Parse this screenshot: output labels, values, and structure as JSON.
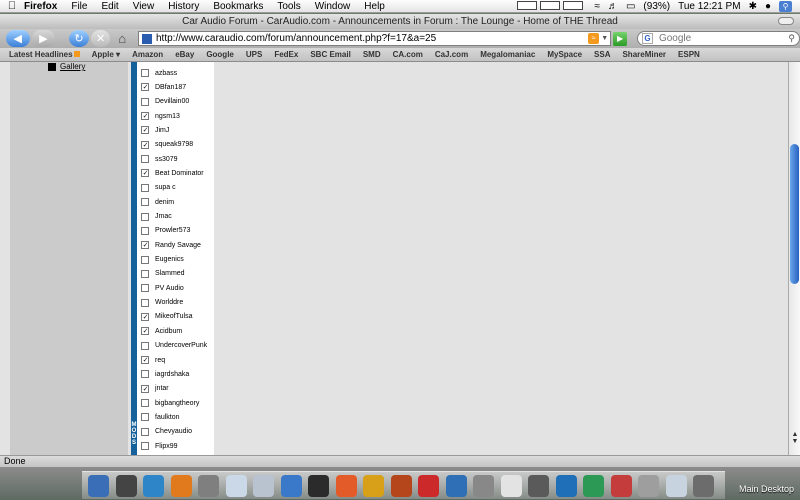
{
  "menubar": {
    "app": "Firefox",
    "items": [
      "File",
      "Edit",
      "View",
      "History",
      "Bookmarks",
      "Tools",
      "Window",
      "Help"
    ],
    "battery": "(93%)",
    "clock": "Tue 12:21 PM"
  },
  "window": {
    "title": "Car Audio Forum - CarAudio.com - Announcements in Forum : The Lounge - Home of THE Thread"
  },
  "toolbar": {
    "url": "http://www.caraudio.com/forum/announcement.php?f=17&a=25",
    "search_placeholder": "Google"
  },
  "bookmarks": [
    "Latest Headlines",
    "Apple",
    "Amazon",
    "eBay",
    "Google",
    "UPS",
    "FedEx",
    "SBC Email",
    "SMD",
    "CA.com",
    "CaJ.com",
    "Megalomaniac",
    "MySpace",
    "SSA",
    "ShareMiner",
    "ESPN"
  ],
  "page": {
    "gallery_link": "Gallery",
    "moderator_strip_text": "MODS",
    "users": [
      {
        "name": "azbass",
        "checked": false
      },
      {
        "name": "DBfan187",
        "checked": true
      },
      {
        "name": "Devillain00",
        "checked": false
      },
      {
        "name": "ngsm13",
        "checked": true
      },
      {
        "name": "JimJ",
        "checked": true
      },
      {
        "name": "squeak9798",
        "checked": true
      },
      {
        "name": "ss3079",
        "checked": false
      },
      {
        "name": "Beat Dominator",
        "checked": true
      },
      {
        "name": "supa c",
        "checked": false
      },
      {
        "name": "denim",
        "checked": false
      },
      {
        "name": "Jmac",
        "checked": false
      },
      {
        "name": "Prowler573",
        "checked": false
      },
      {
        "name": "Randy Savage",
        "checked": true
      },
      {
        "name": "Eugenics",
        "checked": false
      },
      {
        "name": "Slammed",
        "checked": false
      },
      {
        "name": "PV Audio",
        "checked": false
      },
      {
        "name": "Worlddre",
        "checked": false
      },
      {
        "name": "MikeofTulsa",
        "checked": true
      },
      {
        "name": "Acidbum",
        "checked": true
      },
      {
        "name": "UndercoverPunk",
        "checked": false
      },
      {
        "name": "req",
        "checked": true
      },
      {
        "name": "iagrdshaka",
        "checked": false
      },
      {
        "name": "jntar",
        "checked": true
      },
      {
        "name": "bigbangtheory",
        "checked": false
      },
      {
        "name": "faulkton",
        "checked": false
      },
      {
        "name": "Chevyaudio",
        "checked": false
      },
      {
        "name": "Flipx99",
        "checked": false
      }
    ]
  },
  "status": "Done",
  "dock": {
    "label": "Main Desktop",
    "icon_colors": [
      "#3a6fb8",
      "#444444",
      "#2e86c9",
      "#e07a1c",
      "#7f7f7f",
      "#cbd8e8",
      "#b9c3cf",
      "#3a78c9",
      "#2b2b2b",
      "#e45b2a",
      "#d8a018",
      "#b5451b",
      "#cc2a2a",
      "#2f6fb5",
      "#888888",
      "#e3e3e3",
      "#5a5a5a",
      "#1e6fb8",
      "#2c9a55",
      "#c43c3c",
      "#9e9e9e",
      "#c8d3e0",
      "#6c6c6c"
    ],
    "icon_names": [
      "finder-icon",
      "dashboard-icon",
      "safari-icon",
      "firefox-icon",
      "itunes-icon",
      "preview-icon",
      "ichat-icon",
      "quicktime-icon",
      "clapperboard-icon",
      "dvd-icon",
      "photos-icon",
      "server-icon",
      "calendar-icon",
      "app-icon",
      "terminal-icon",
      "textedit-icon",
      "network-icon",
      "word-icon",
      "excel-icon",
      "powerpoint-icon",
      "system-preferences-icon",
      "mail-icon",
      "trash-icon"
    ]
  }
}
